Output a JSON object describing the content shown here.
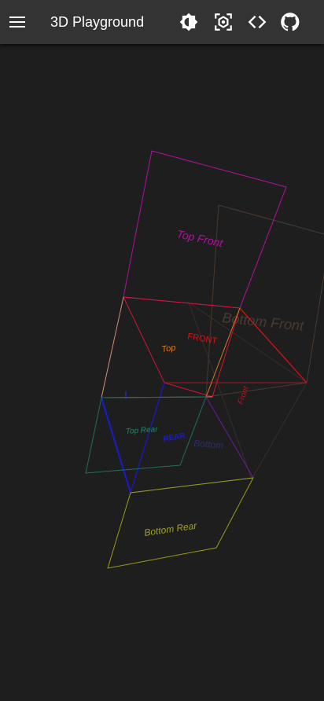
{
  "app_bar": {
    "title": "3D Playground",
    "menu_icon": "menu-icon",
    "actions": [
      {
        "name": "theme-toggle",
        "icon": "brightness-icon"
      },
      {
        "name": "capture",
        "icon": "camera-focus-icon"
      },
      {
        "name": "view-source",
        "icon": "code-icon"
      },
      {
        "name": "github",
        "icon": "github-icon"
      }
    ]
  },
  "scene": {
    "faces": {
      "top_front": {
        "label": "Top Front",
        "color": "#b0119e"
      },
      "bottom_front": {
        "label": "Bottom Front",
        "color": "#4a3a30"
      },
      "front": {
        "label": "FRONT",
        "color": "#e01010"
      },
      "top": {
        "label": "Top",
        "color": "#e07a22"
      },
      "front_side": {
        "label": "Front",
        "color": "#c01020"
      },
      "top_rear": {
        "label": "Top Rear",
        "color": "#1e8a6e"
      },
      "rear": {
        "label": "REAR",
        "color": "#1a1ad0"
      },
      "bottom": {
        "label": "Bottom",
        "color": "#2a2e6a"
      },
      "bottom_rear": {
        "label": "Bottom Rear",
        "color": "#a0a020"
      },
      "edge_axis": {
        "label": "I",
        "color": "#2a2ad8"
      }
    }
  }
}
